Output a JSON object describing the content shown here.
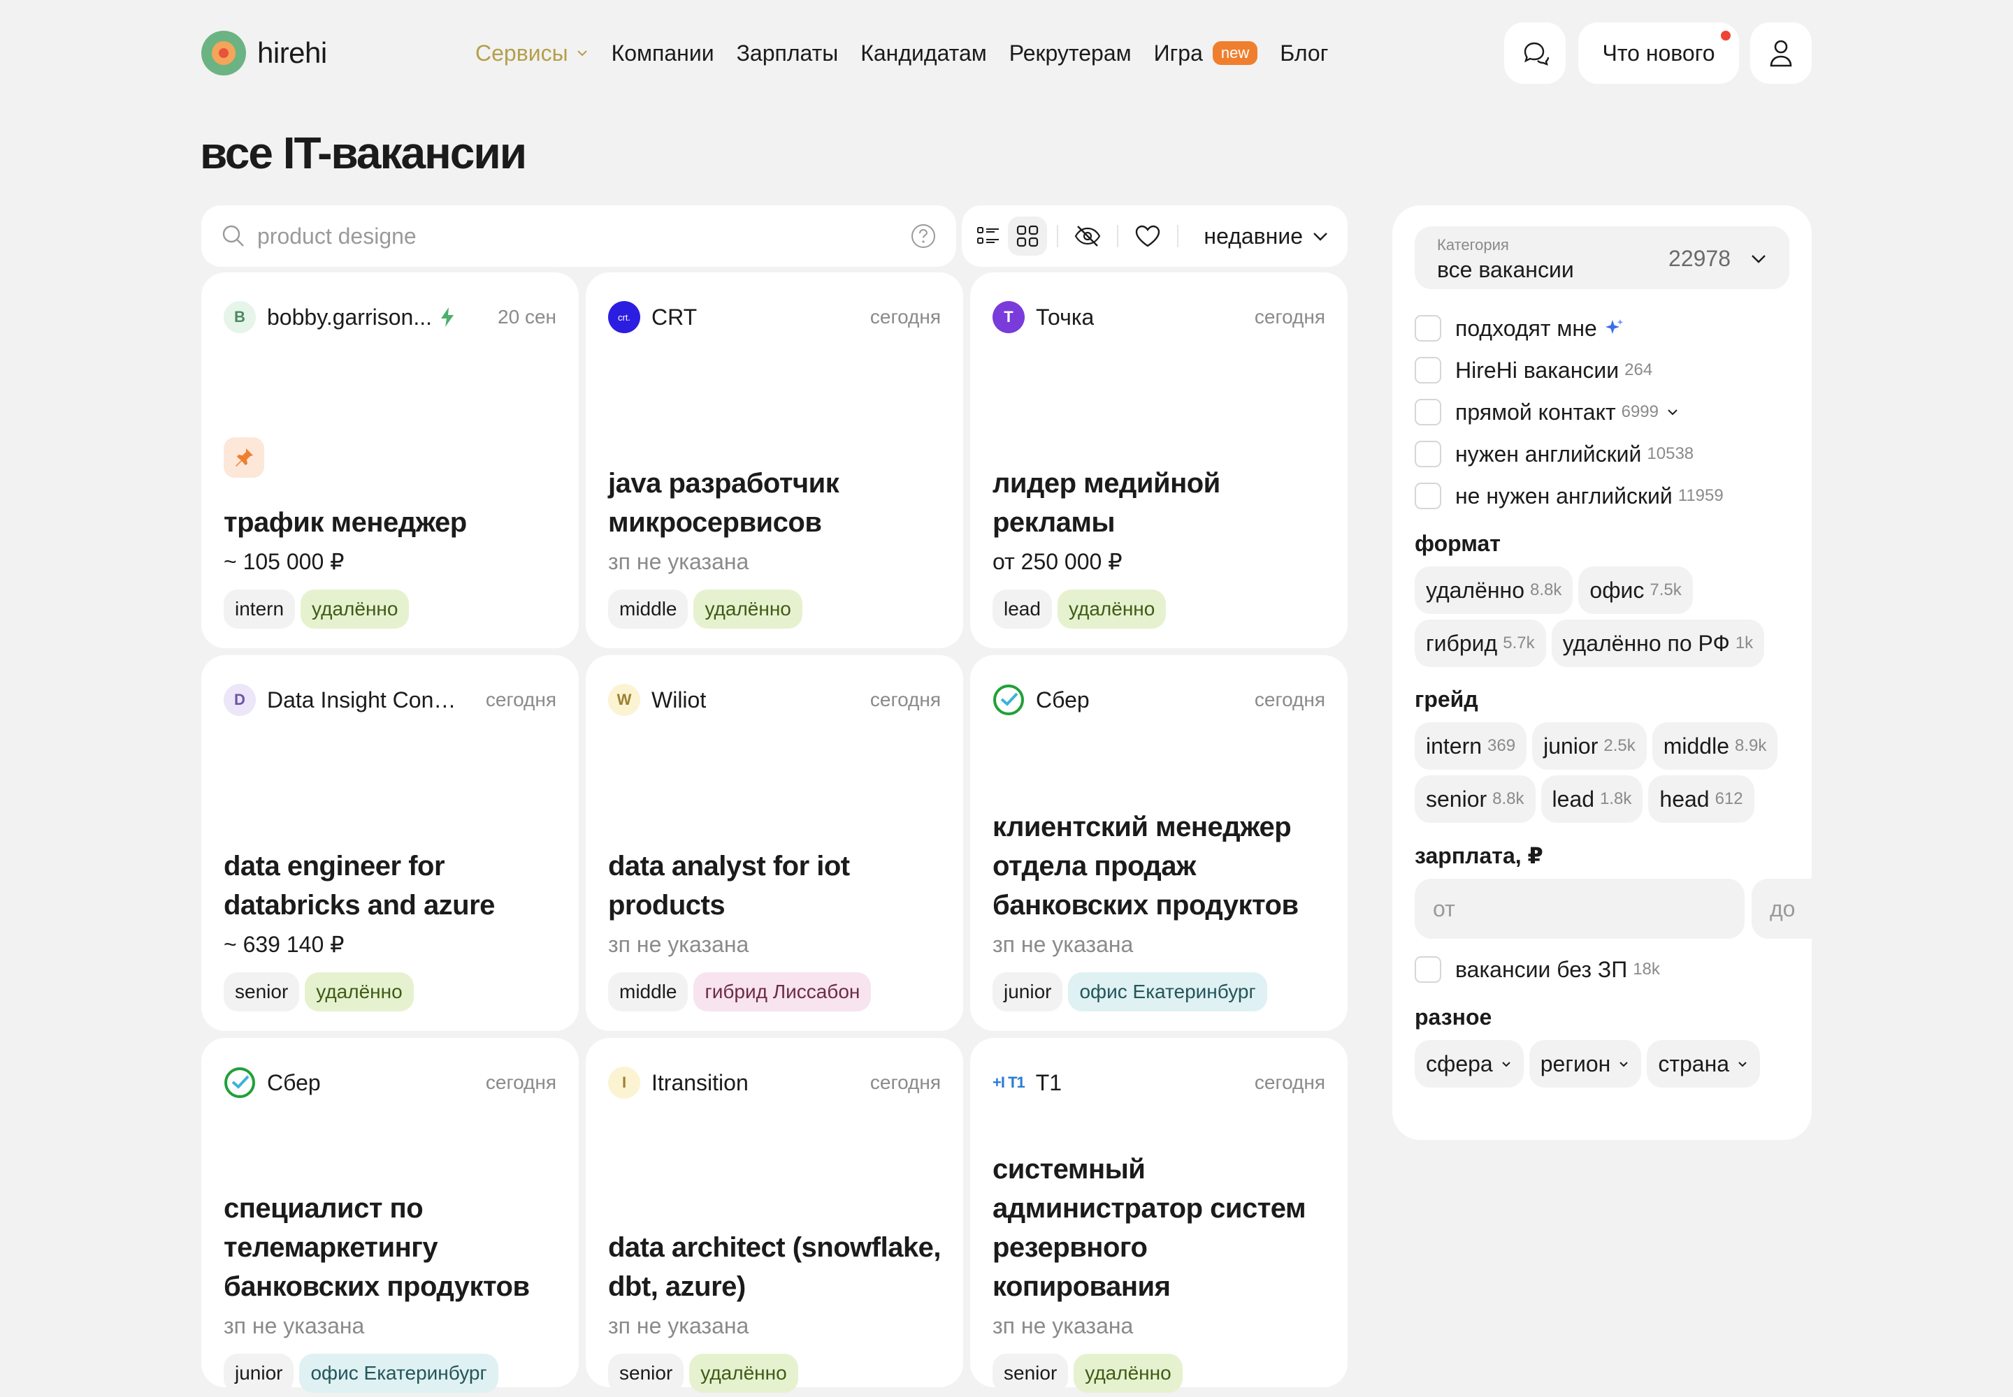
{
  "brand": {
    "name": "hirehi"
  },
  "nav": {
    "items": [
      {
        "label": "Сервисы"
      },
      {
        "label": "Компании"
      },
      {
        "label": "Зарплаты"
      },
      {
        "label": "Кандидатам"
      },
      {
        "label": "Рекрутерам"
      },
      {
        "label": "Игра",
        "badge": "new"
      },
      {
        "label": "Блог"
      }
    ],
    "whats_new": "Что нового"
  },
  "page_title": "все IT-вакансии",
  "search": {
    "value": "",
    "placeholder": "product designe"
  },
  "toolbar": {
    "sort_label": "недавние"
  },
  "cards": [
    {
      "company": "bobby.garrison...",
      "logo_letter": "B",
      "date": "20 сен",
      "title": "трафик менеджер",
      "salary": "~ 105 000 ₽",
      "tags": [
        "intern",
        "удалённо"
      ]
    },
    {
      "company": "CRT",
      "logo_letter": "crt.",
      "date": "сегодня",
      "title": "java разработчик микросервисов",
      "salary": "зп не указана",
      "tags": [
        "middle",
        "удалённо"
      ]
    },
    {
      "company": "Точка",
      "logo_letter": "T",
      "date": "сегодня",
      "title": "лидер медийной рекламы",
      "salary": "от 250 000 ₽",
      "tags": [
        "lead",
        "удалённо"
      ]
    },
    {
      "company": "Data Insight Cons...",
      "logo_letter": "D",
      "date": "сегодня",
      "title": "data engineer for databricks and azure",
      "salary": "~ 639 140 ₽",
      "tags": [
        "senior",
        "удалённо"
      ]
    },
    {
      "company": "Wiliot",
      "logo_letter": "W",
      "date": "сегодня",
      "title": "data analyst for iot products",
      "salary": "зп не указана",
      "tags": [
        "middle",
        "гибрид Лиссабон"
      ]
    },
    {
      "company": "Сбер",
      "logo_letter": "",
      "date": "сегодня",
      "title": "клиентский менеджер отдела продаж банковских продуктов",
      "salary": "зп не указана",
      "tags": [
        "junior",
        "офис Екатеринбург"
      ]
    },
    {
      "company": "Сбер",
      "logo_letter": "",
      "date": "сегодня",
      "title": "специалист по телемаркетингу банковских продуктов",
      "salary": "зп не указана",
      "tags": [
        "junior",
        "офис Екатеринбург"
      ]
    },
    {
      "company": "Itransition",
      "logo_letter": "I",
      "date": "сегодня",
      "title": "data architect (snowflake, dbt, azure)",
      "salary": "зп не указана",
      "tags": [
        "senior",
        "удалённо"
      ]
    },
    {
      "company": "T1",
      "logo_letter": "+I T1",
      "date": "сегодня",
      "title": "системный администратор систем резервного копирования",
      "salary": "зп не указана",
      "tags": [
        "senior",
        "удалённо"
      ]
    }
  ],
  "sidebar": {
    "category": {
      "label": "Категория",
      "value": "все вакансии",
      "count": "22978"
    },
    "checks": [
      {
        "label": "подходят мне",
        "count": ""
      },
      {
        "label": "HireHi вакансии",
        "count": "264"
      },
      {
        "label": "прямой контакт",
        "count": "6999"
      },
      {
        "label": "нужен английский",
        "count": "10538"
      },
      {
        "label": "не нужен английский",
        "count": "11959"
      }
    ],
    "format": {
      "title": "формат",
      "chips": [
        {
          "label": "удалённо",
          "count": "8.8k"
        },
        {
          "label": "офис",
          "count": "7.5k"
        },
        {
          "label": "гибрид",
          "count": "5.7k"
        },
        {
          "label": "удалённо по РФ",
          "count": "1k"
        }
      ]
    },
    "grade": {
      "title": "грейд",
      "chips": [
        {
          "label": "intern",
          "count": "369"
        },
        {
          "label": "junior",
          "count": "2.5k"
        },
        {
          "label": "middle",
          "count": "8.9k"
        },
        {
          "label": "senior",
          "count": "8.8k"
        },
        {
          "label": "lead",
          "count": "1.8k"
        },
        {
          "label": "head",
          "count": "612"
        }
      ]
    },
    "salary": {
      "title": "зарплата, ₽",
      "from_placeholder": "от",
      "to_placeholder": "до",
      "no_salary_label": "вакансии без ЗП",
      "no_salary_count": "18k"
    },
    "misc": {
      "title": "разное",
      "chips": [
        {
          "label": "сфера"
        },
        {
          "label": "регион"
        },
        {
          "label": "страна"
        }
      ]
    }
  },
  "colors": {
    "accent_orange": "#ef7f2f",
    "brand_green": "#6cb383",
    "tag_green": "#e6f2cf"
  }
}
